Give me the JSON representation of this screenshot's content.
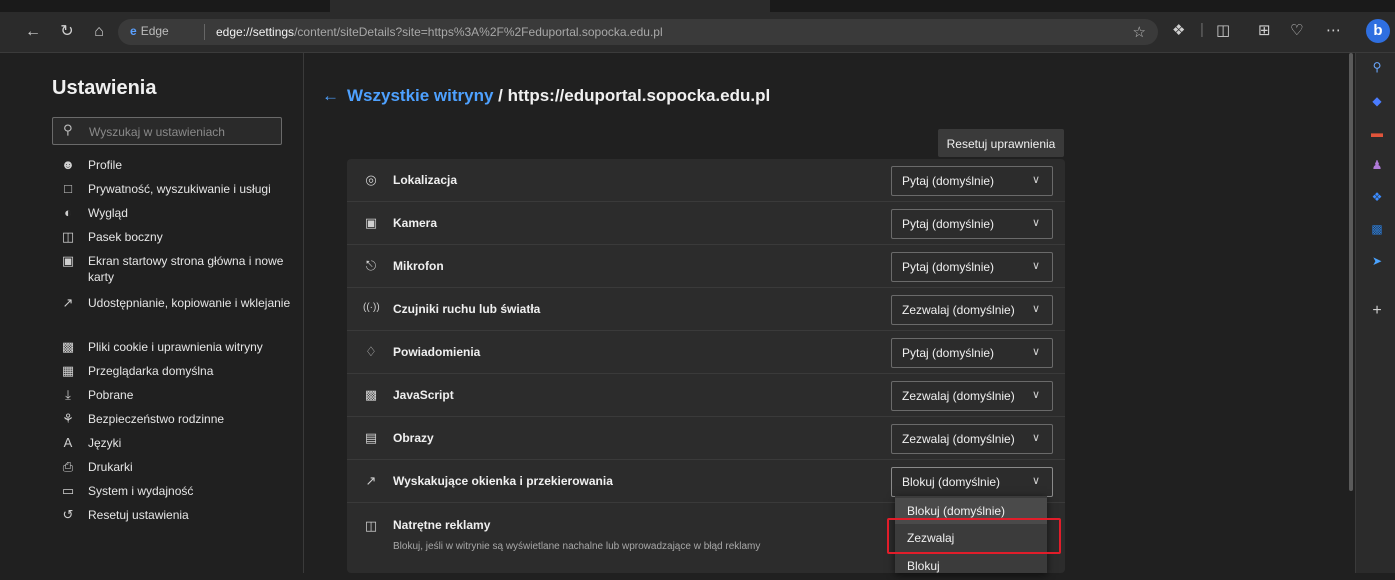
{
  "browser": {
    "edge_label": "Edge",
    "url_bold": "edge://settings",
    "url_rest": "/content/siteDetails?site=https%3A%2F%2Feduportal.sopocka.edu.pl",
    "profile_letter": "b"
  },
  "sidebar": {
    "title": "Ustawienia",
    "search_placeholder": "Wyszukaj w ustawieniach",
    "items": [
      {
        "label": "Profile",
        "icon": "profile-icon"
      },
      {
        "label": "Prywatność, wyszukiwanie i usługi",
        "icon": "lock-icon"
      },
      {
        "label": "Wygląd",
        "icon": "appearance-icon"
      },
      {
        "label": "Pasek boczny",
        "icon": "sidebar-icon"
      },
      {
        "label": "Ekran startowy strona główna i nowe karty",
        "icon": "home-screen-icon"
      },
      {
        "label": "Udostępnianie, kopiowanie i wklejanie",
        "icon": "share-icon"
      },
      {
        "label": "Pliki cookie i uprawnienia witryny",
        "icon": "cookie-icon"
      },
      {
        "label": "Przeglądarka domyślna",
        "icon": "default-browser-icon"
      },
      {
        "label": "Pobrane",
        "icon": "download-icon"
      },
      {
        "label": "Bezpieczeństwo rodzinne",
        "icon": "family-icon"
      },
      {
        "label": "Języki",
        "icon": "language-icon"
      },
      {
        "label": "Drukarki",
        "icon": "printer-icon"
      },
      {
        "label": "System i wydajność",
        "icon": "system-icon"
      },
      {
        "label": "Resetuj ustawienia",
        "icon": "reset-icon"
      }
    ]
  },
  "main": {
    "breadcrumb_link": "Wszystkie witryny",
    "breadcrumb_sep": " / ",
    "site": "https://eduportal.sopocka.edu.pl",
    "reset_label": "Resetuj uprawnienia",
    "permissions": [
      {
        "label": "Lokalizacja",
        "value": "Pytaj (domyślnie)",
        "icon": "location-icon"
      },
      {
        "label": "Kamera",
        "value": "Pytaj (domyślnie)",
        "icon": "camera-icon"
      },
      {
        "label": "Mikrofon",
        "value": "Pytaj (domyślnie)",
        "icon": "microphone-icon"
      },
      {
        "label": "Czujniki ruchu lub światła",
        "value": "Zezwalaj (domyślnie)",
        "icon": "sensor-icon"
      },
      {
        "label": "Powiadomienia",
        "value": "Pytaj (domyślnie)",
        "icon": "bell-icon"
      },
      {
        "label": "JavaScript",
        "value": "Zezwalaj (domyślnie)",
        "icon": "javascript-icon"
      },
      {
        "label": "Obrazy",
        "value": "Zezwalaj (domyślnie)",
        "icon": "image-icon"
      },
      {
        "label": "Wyskakujące okienka i przekierowania",
        "value": "Blokuj (domyślnie)",
        "icon": "popup-icon"
      },
      {
        "label": "Natrętne reklamy",
        "sublabel": "Blokuj, jeśli w witrynie są wyświetlane nachalne lub wprowadzające w błąd reklamy",
        "icon": "ads-icon"
      }
    ],
    "dropdown_options": [
      "Blokuj (domyślnie)",
      "Zezwalaj",
      "Blokuj"
    ]
  },
  "colors": {
    "accent": "#4ea1ff",
    "highlight": "#e11d2a"
  }
}
